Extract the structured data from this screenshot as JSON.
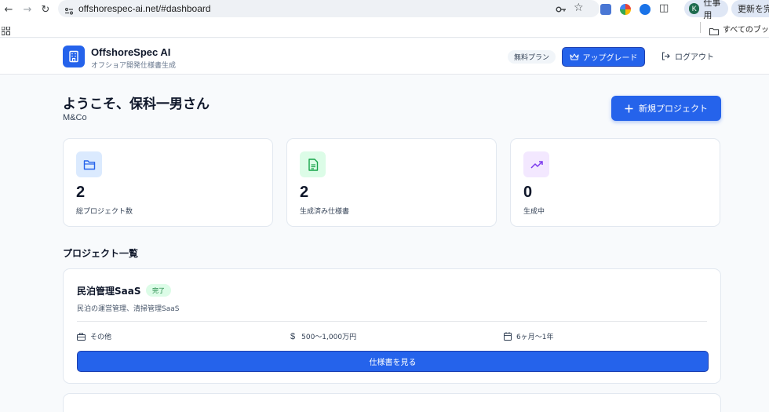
{
  "browser": {
    "url": "offshorespec-ai.net/#dashboard",
    "profile_initial": "K",
    "profile_label": "仕事用",
    "update_label": "更新を完了",
    "bookmarks_label": "すべてのブックマーク"
  },
  "header": {
    "brand": "OffshoreSpec AI",
    "tagline": "オフショア開発仕様書生成",
    "plan_badge": "無料プラン",
    "upgrade_label": "アップグレード",
    "logout_label": "ログアウト"
  },
  "welcome": {
    "greeting": "ようこそ、保科一男さん",
    "company": "M&Co",
    "new_project_label": "新規プロジェクト"
  },
  "stats": [
    {
      "value": "2",
      "label": "総プロジェクト数",
      "icon": "folder-icon",
      "color": "#2563eb",
      "bg": "#dbeafe"
    },
    {
      "value": "2",
      "label": "生成済み仕様書",
      "icon": "document-icon",
      "color": "#16a34a",
      "bg": "#dcfce7"
    },
    {
      "value": "0",
      "label": "生成中",
      "icon": "trending-up-icon",
      "color": "#7c3aed",
      "bg": "#f3e8ff"
    }
  ],
  "projects_section": {
    "title": "プロジェクト一覧",
    "projects": [
      {
        "name": "民泊管理SaaS",
        "status": "完了",
        "description": "民泊の運営管理、清掃管理SaaS",
        "category": "その他",
        "budget": "500〜1,000万円",
        "duration": "6ヶ月〜1年",
        "view_label": "仕様書を見る"
      }
    ]
  }
}
